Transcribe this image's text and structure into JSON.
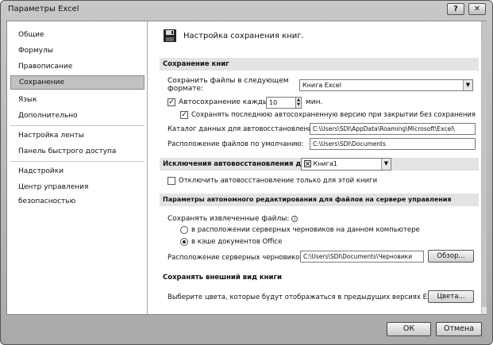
{
  "window": {
    "title": "Параметры Excel",
    "help_glyph": "?",
    "close_glyph": "✕"
  },
  "nav": {
    "items": [
      "Общие",
      "Формулы",
      "Правописание",
      "Сохранение",
      "Язык",
      "Дополнительно",
      "Настройка ленты",
      "Панель быстрого доступа",
      "Надстройки",
      "Центр управления безопасностью"
    ],
    "selected": "Сохранение"
  },
  "page": {
    "title": "Настройка сохранения книг.",
    "icon": "floppy-disk-icon"
  },
  "save": {
    "header": "Сохранение книг",
    "format_label_1": "Сохранить файлы в следующем",
    "format_label_2": "формате:",
    "format_value": "Книга Excel",
    "autosave_label": "Автосохранение каждые",
    "autosave_value": "10",
    "autosave_unit": "мин.",
    "autosave_checked": true,
    "keep_last_label": "Сохранять последнюю автосохраненную версию при закрытии без сохранения",
    "keep_last_checked": true,
    "autorecover_dir_label": "Каталог данных для автовосстановления:",
    "autorecover_dir_value": "C:\\Users\\SDI\\AppData\\Roaming\\Microsoft\\Excel\\",
    "default_dir_label": "Расположение файлов по умолчанию:",
    "default_dir_value": "C:\\Users\\SDI\\Documents"
  },
  "exceptions": {
    "header": "Исключения автовосстановления для:",
    "workbook_value": "Книга1",
    "disable_label": "Отключить автовосстановление только для этой книги",
    "disable_checked": false
  },
  "offline": {
    "header": "Параметры автономного редактирования для файлов на сервере управления документами",
    "save_extracted_label": "Сохранять извлеченные файлы:",
    "info_glyph": "i",
    "radio_server_label": "в расположении серверных черновиков на данном компьютере",
    "radio_office_label": "в кэше документов Office",
    "selected": "radio_office",
    "drafts_label": "Расположение серверных черновиков:",
    "drafts_value": "C:\\Users\\SDI\\Documents\\Черновики",
    "browse_label": "Обзор..."
  },
  "appearance": {
    "header": "Сохранять внешний вид книги",
    "colors_label": "Выберите цвета, которые будут отображаться в предыдущих версиях Excel:",
    "colors_button": "Цвета..."
  },
  "footer": {
    "ok": "ОК",
    "cancel": "Отмена"
  }
}
